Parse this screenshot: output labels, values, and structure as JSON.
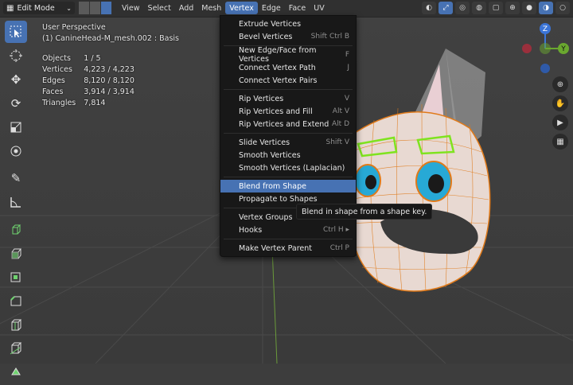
{
  "header": {
    "mode": "Edit Mode",
    "menus": [
      {
        "label": "View"
      },
      {
        "label": "Select"
      },
      {
        "label": "Add"
      },
      {
        "label": "Mesh"
      },
      {
        "label": "Vertex",
        "active": true
      },
      {
        "label": "Edge"
      },
      {
        "label": "Face"
      },
      {
        "label": "UV"
      }
    ],
    "accent_color": "#4772b3"
  },
  "viewport": {
    "title": "User Perspective",
    "object_name": "(1) CanineHead-M_mesh.002 : Basis",
    "stats": [
      {
        "label": "Objects",
        "value": "1 / 5"
      },
      {
        "label": "Vertices",
        "value": "4,223 / 4,223"
      },
      {
        "label": "Edges",
        "value": "8,120 / 8,120"
      },
      {
        "label": "Faces",
        "value": "3,914 / 3,914"
      },
      {
        "label": "Triangles",
        "value": "7,814"
      }
    ]
  },
  "gizmo": {
    "z_label": "Z",
    "y_label": "Y"
  },
  "vertex_menu": {
    "items": [
      {
        "label": "Extrude Vertices",
        "shortcut": ""
      },
      {
        "label": "Bevel Vertices",
        "shortcut": "Shift Ctrl B"
      },
      {
        "separator": true
      },
      {
        "label": "New Edge/Face from Vertices",
        "shortcut": "F"
      },
      {
        "label": "Connect Vertex Path",
        "shortcut": "J"
      },
      {
        "label": "Connect Vertex Pairs",
        "shortcut": ""
      },
      {
        "separator": true
      },
      {
        "label": "Rip Vertices",
        "shortcut": "V"
      },
      {
        "label": "Rip Vertices and Fill",
        "shortcut": "Alt V"
      },
      {
        "label": "Rip Vertices and Extend",
        "shortcut": "Alt D"
      },
      {
        "separator": true
      },
      {
        "label": "Slide Vertices",
        "shortcut": "Shift V"
      },
      {
        "label": "Smooth Vertices",
        "shortcut": ""
      },
      {
        "label": "Smooth Vertices (Laplacian)",
        "shortcut": ""
      },
      {
        "separator": true
      },
      {
        "label": "Blend from Shape",
        "shortcut": "",
        "highlighted": true
      },
      {
        "label": "Propagate to Shapes",
        "shortcut": ""
      },
      {
        "separator": true
      },
      {
        "label": "Vertex Groups",
        "shortcut": ""
      },
      {
        "label": "Hooks",
        "shortcut": "Ctrl H ▸"
      },
      {
        "separator": true
      },
      {
        "label": "Make Vertex Parent",
        "shortcut": "Ctrl P"
      }
    ]
  },
  "tooltip": {
    "text": "Blend in shape from a shape key."
  },
  "toolbar_icons": [
    "select-box-icon",
    "cursor-icon",
    "move-icon",
    "rotate-icon",
    "scale-icon",
    "transform-icon",
    "annotate-icon",
    "measure-icon",
    "add-cube-icon",
    "extrude-icon",
    "inset-icon",
    "bevel-icon",
    "loop-cut-icon",
    "knife-icon",
    "poly-build-icon"
  ]
}
